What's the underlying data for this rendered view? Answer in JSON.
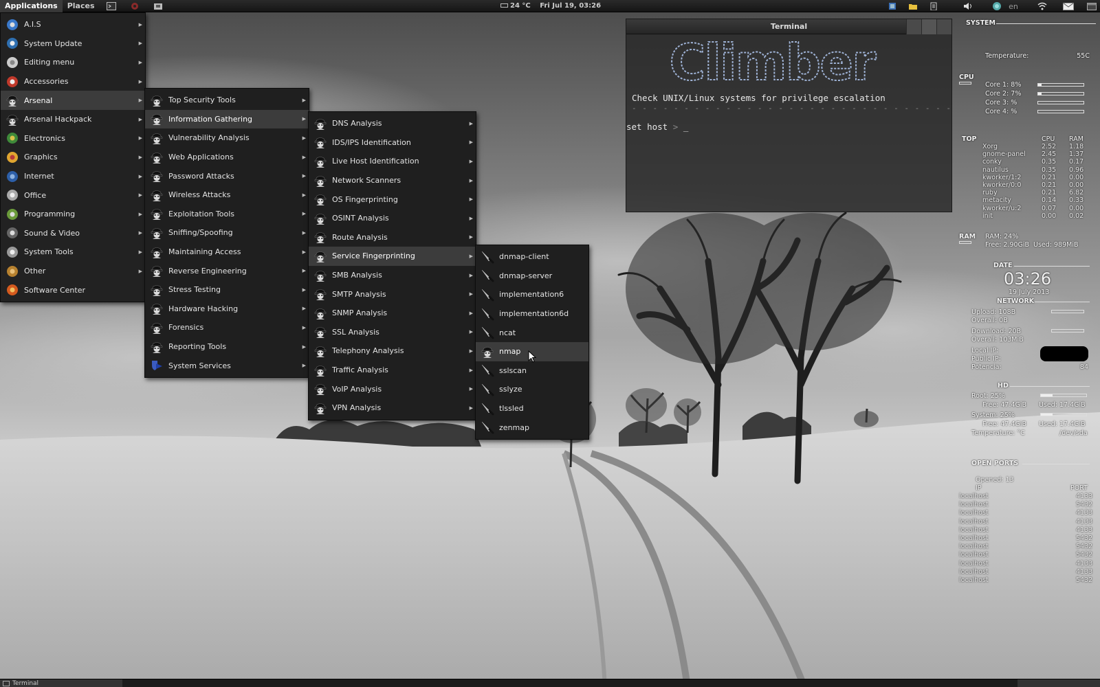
{
  "top_panel": {
    "applications": "Applications",
    "places": "Places",
    "temperature": "24 °C",
    "datetime": "Fri Jul 19, 03:26",
    "language": "en",
    "icons": [
      "terminal-launcher-icon",
      "browser-launcher-icon",
      "file-manager-icon",
      "chat-icon",
      "folder-icon",
      "clipboard-icon",
      "volume-icon",
      "status-icon",
      "wifi-icon",
      "mail-icon",
      "window-icon"
    ]
  },
  "apps_menu": {
    "items": [
      {
        "label": "A.I.S",
        "icon": "ais-icon"
      },
      {
        "label": "System Update",
        "icon": "update-icon"
      },
      {
        "label": "Editing menu",
        "icon": "editing-icon"
      },
      {
        "label": "Accessories",
        "icon": "accessories-icon"
      },
      {
        "label": "Arsenal",
        "icon": "arsenal-icon"
      },
      {
        "label": "Arsenal Hackpack",
        "icon": "hackpack-icon"
      },
      {
        "label": "Electronics",
        "icon": "electronics-icon"
      },
      {
        "label": "Graphics",
        "icon": "graphics-icon"
      },
      {
        "label": "Internet",
        "icon": "internet-icon"
      },
      {
        "label": "Office",
        "icon": "office-icon"
      },
      {
        "label": "Programming",
        "icon": "programming-icon"
      },
      {
        "label": "Sound & Video",
        "icon": "sound-video-icon"
      },
      {
        "label": "System Tools",
        "icon": "system-tools-icon"
      },
      {
        "label": "Other",
        "icon": "other-icon"
      },
      {
        "label": "Software Center",
        "icon": "software-center-icon"
      }
    ]
  },
  "arsenal_menu": {
    "items": [
      {
        "label": "Top Security Tools"
      },
      {
        "label": "Information Gathering"
      },
      {
        "label": "Vulnerability Analysis"
      },
      {
        "label": "Web Applications"
      },
      {
        "label": "Password Attacks"
      },
      {
        "label": "Wireless Attacks"
      },
      {
        "label": "Exploitation Tools"
      },
      {
        "label": "Sniffing/Spoofing"
      },
      {
        "label": "Maintaining Access"
      },
      {
        "label": "Reverse Engineering"
      },
      {
        "label": "Stress Testing"
      },
      {
        "label": "Hardware Hacking"
      },
      {
        "label": "Forensics"
      },
      {
        "label": "Reporting Tools"
      },
      {
        "label": "System Services"
      }
    ]
  },
  "info_menu": {
    "items": [
      {
        "label": "DNS Analysis"
      },
      {
        "label": "IDS/IPS Identification"
      },
      {
        "label": "Live Host Identification"
      },
      {
        "label": "Network Scanners"
      },
      {
        "label": "OS Fingerprinting"
      },
      {
        "label": "OSINT Analysis"
      },
      {
        "label": "Route Analysis"
      },
      {
        "label": "Service Fingerprinting"
      },
      {
        "label": "SMB Analysis"
      },
      {
        "label": "SMTP Analysis"
      },
      {
        "label": "SNMP Analysis"
      },
      {
        "label": "SSL Analysis"
      },
      {
        "label": "Telephony Analysis"
      },
      {
        "label": "Traffic Analysis"
      },
      {
        "label": "VoIP Analysis"
      },
      {
        "label": "VPN Analysis"
      }
    ]
  },
  "service_menu": {
    "items": [
      {
        "label": "dnmap-client"
      },
      {
        "label": "dnmap-server"
      },
      {
        "label": "implementation6"
      },
      {
        "label": "implementation6d"
      },
      {
        "label": "ncat"
      },
      {
        "label": "nmap"
      },
      {
        "label": "sslscan"
      },
      {
        "label": "sslyze"
      },
      {
        "label": "tlssled"
      },
      {
        "label": "zenmap"
      }
    ]
  },
  "terminal": {
    "title": "Terminal",
    "banner": "Climber",
    "description": "Check UNIX/Linux systems for privilege escalation",
    "dashes": "- - - - - - - - - - - - - - - - - - - - - - - - - - - - - - -",
    "prompt": "set host",
    "prompt_sep": ">",
    "cursor": "_"
  },
  "conky": {
    "system": "SYSTEM",
    "temperature_label": "Temperature:",
    "temperature_value": "55C",
    "cpu": "CPU",
    "cores": [
      {
        "label": "Core 1: 8%",
        "level": 0.08
      },
      {
        "label": "Core 2: 7%",
        "level": 0.07
      },
      {
        "label": "Core 3: %",
        "level": 0.0
      },
      {
        "label": "Core 4: %",
        "level": 0.0
      }
    ],
    "top": "TOP",
    "top_cpu": "CPU",
    "top_ram": "RAM",
    "processes": [
      {
        "name": "Xorg",
        "cpu": "2.52",
        "ram": "1.18"
      },
      {
        "name": "gnome-panel",
        "cpu": "2.45",
        "ram": "1.37"
      },
      {
        "name": "conky",
        "cpu": "0.35",
        "ram": "0.17"
      },
      {
        "name": "nautilus",
        "cpu": "0.35",
        "ram": "0.96"
      },
      {
        "name": "kworker/1:2",
        "cpu": "0.21",
        "ram": "0.00"
      },
      {
        "name": "kworker/0:0",
        "cpu": "0.21",
        "ram": "0.00"
      },
      {
        "name": "ruby",
        "cpu": "0.21",
        "ram": "6.82"
      },
      {
        "name": "metacity",
        "cpu": "0.14",
        "ram": "0.33"
      },
      {
        "name": "kworker/u:2",
        "cpu": "0.07",
        "ram": "0.00"
      },
      {
        "name": "init",
        "cpu": "0.00",
        "ram": "0.02"
      }
    ],
    "ram": "RAM",
    "ram_pct": "RAM: 24%",
    "ram_free": "Free: 2.90GiB",
    "ram_used": "Used: 989MiB",
    "date": "DATE",
    "clock": "03:26",
    "date_long": "19 July 2013",
    "network": "NETWORK",
    "upload": "Upload: 108B",
    "upload_overall": "Overall: 0B",
    "download": "Download: 20B",
    "download_overall": "Overall: 103MiB",
    "local_ip": "Local IP:",
    "public_ip": "Public IP:",
    "potencia": "Potencia:",
    "potencia_value": "84",
    "hd": "HD",
    "root": "Root: 25%",
    "root_free": "Free: 47.4GiB",
    "root_used": "Used: 17.4GiB",
    "system_hd": "System: 25%",
    "system_free": "Free: 47.4GiB",
    "system_used": "Used: 17.4GiB",
    "temperature_hd": "Temperature: °C",
    "dev": "/dev/sda",
    "open_ports": "OPEN PORTS",
    "opened": "Opened: 13",
    "ip_col": "IP",
    "port_col": "PORT",
    "ports": [
      {
        "host": "localhost",
        "port": "4133"
      },
      {
        "host": "localhost",
        "port": "5432"
      },
      {
        "host": "localhost",
        "port": "4133"
      },
      {
        "host": "localhost",
        "port": "4133"
      },
      {
        "host": "localhost",
        "port": "4133"
      },
      {
        "host": "localhost",
        "port": "5432"
      },
      {
        "host": "localhost",
        "port": "5432"
      },
      {
        "host": "localhost",
        "port": "5432"
      },
      {
        "host": "localhost",
        "port": "4133"
      },
      {
        "host": "localhost",
        "port": "4133"
      },
      {
        "host": "localhost",
        "port": "5432"
      }
    ]
  },
  "bottom_panel": {
    "task": "Terminal"
  }
}
